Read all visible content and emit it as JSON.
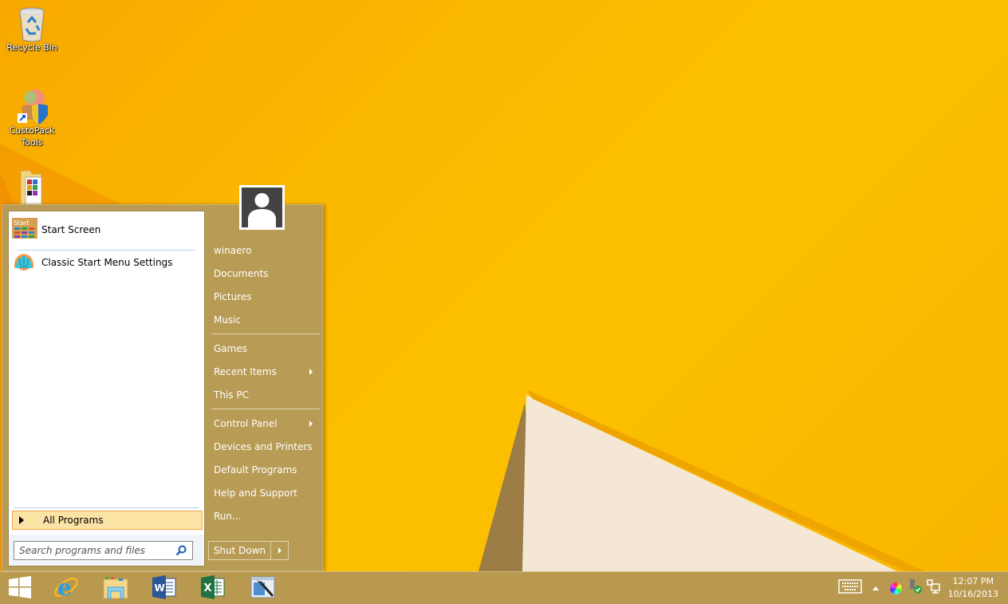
{
  "desktop": {
    "icons": [
      {
        "label": "Recycle Bin",
        "icon": "recycle-bin-icon"
      },
      {
        "label": "CustoPack Tools",
        "icon": "custopack-tools-icon"
      },
      {
        "label": "",
        "icon": "folder-icon"
      }
    ]
  },
  "start_menu": {
    "pinned": [
      {
        "label": "Start Screen",
        "icon": "start-screen-icon",
        "icon_text": "Start"
      },
      {
        "label": "Classic Start Menu Settings",
        "icon": "classic-shell-icon"
      }
    ],
    "all_programs_label": "All Programs",
    "search": {
      "placeholder": "Search programs and files",
      "value": ""
    },
    "user": {
      "name": "winaero"
    },
    "right_items": [
      {
        "label": "winaero",
        "submenu": false
      },
      {
        "label": "Documents",
        "submenu": false
      },
      {
        "label": "Pictures",
        "submenu": false
      },
      {
        "label": "Music",
        "submenu": false
      },
      {
        "label": "Games",
        "submenu": false
      },
      {
        "label": "Recent Items",
        "submenu": true
      },
      {
        "label": "This PC",
        "submenu": false
      },
      {
        "label": "Control Panel",
        "submenu": true
      },
      {
        "label": "Devices and Printers",
        "submenu": false
      },
      {
        "label": "Default Programs",
        "submenu": false
      },
      {
        "label": "Help and Support",
        "submenu": false
      },
      {
        "label": "Run...",
        "submenu": false
      }
    ],
    "shutdown_label": "Shut Down"
  },
  "taskbar": {
    "pinned": [
      {
        "name": "start-button",
        "icon": "windows-logo-icon"
      },
      {
        "name": "internet-explorer",
        "icon": "internet-explorer-icon",
        "glyph": "e"
      },
      {
        "name": "file-explorer",
        "icon": "file-explorer-icon"
      },
      {
        "name": "word",
        "icon": "word-icon",
        "glyph": "W"
      },
      {
        "name": "excel",
        "icon": "excel-icon",
        "glyph": "X"
      },
      {
        "name": "app-tool",
        "icon": "app-tool-icon"
      }
    ],
    "tray": [
      "touch-keyboard-icon",
      "show-hidden-icons-icon",
      "color-icon",
      "safely-remove-hardware-icon",
      "network-icon"
    ],
    "time": "12:07 PM",
    "date": "10/16/2013"
  },
  "colors": {
    "menu_bg": "#b89b54",
    "taskbar_bg": "#b9994f",
    "all_programs_highlight": "#fbe3a6",
    "wallpaper": "#fbbd00"
  }
}
